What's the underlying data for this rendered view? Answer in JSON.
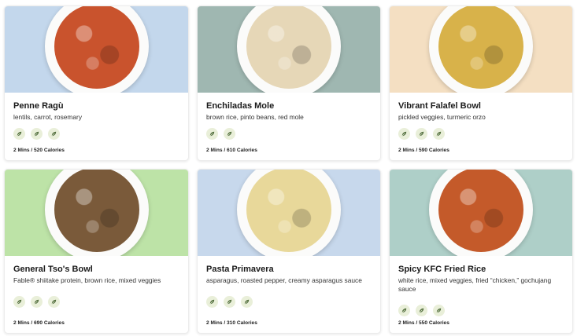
{
  "menu": {
    "items": [
      {
        "title": "Penne Ragù",
        "description": "lentils, carrot, rosemary",
        "meta": "2 Mins / 520 Calories",
        "tags": [
          "plant-icon",
          "plant-icon",
          "plant-icon"
        ],
        "bg_color": "#c3d7ec",
        "food_color": "#c9532d"
      },
      {
        "title": "Enchiladas Mole",
        "description": "brown rice, pinto beans, red mole",
        "meta": "2 Mins / 610 Calories",
        "tags": [
          "plant-icon",
          "plant-icon"
        ],
        "bg_color": "#9fb7b1",
        "food_color": "#e6d7b7"
      },
      {
        "title": "Vibrant Falafel Bowl",
        "description": "pickled veggies, turmeric orzo",
        "meta": "2 Mins / 590 Calories",
        "tags": [
          "plant-icon",
          "plant-icon",
          "plant-icon"
        ],
        "bg_color": "#f4dfc2",
        "food_color": "#d8b24a"
      },
      {
        "title": "General Tso's Bowl",
        "description": "Fable® shiitake protein, brown rice, mixed veggies",
        "meta": "2 Mins / 690 Calories",
        "tags": [
          "plant-icon",
          "plant-icon",
          "plant-icon"
        ],
        "bg_color": "#bde3a7",
        "food_color": "#7a5a3a"
      },
      {
        "title": "Pasta Primavera",
        "description": "asparagus, roasted pepper, creamy asparagus sauce",
        "meta": "2 Mins / 310 Calories",
        "tags": [
          "plant-icon",
          "plant-icon",
          "plant-icon"
        ],
        "bg_color": "#c7d8ec",
        "food_color": "#e8d89a"
      },
      {
        "title": "Spicy KFC Fried Rice",
        "description": "white rice, mixed veggies, fried “chicken,” gochujang sauce",
        "meta": "2 Mins / 550 Calories",
        "tags": [
          "plant-icon",
          "plant-icon",
          "plant-icon"
        ],
        "bg_color": "#aecfc8",
        "food_color": "#c45a2a"
      }
    ]
  }
}
